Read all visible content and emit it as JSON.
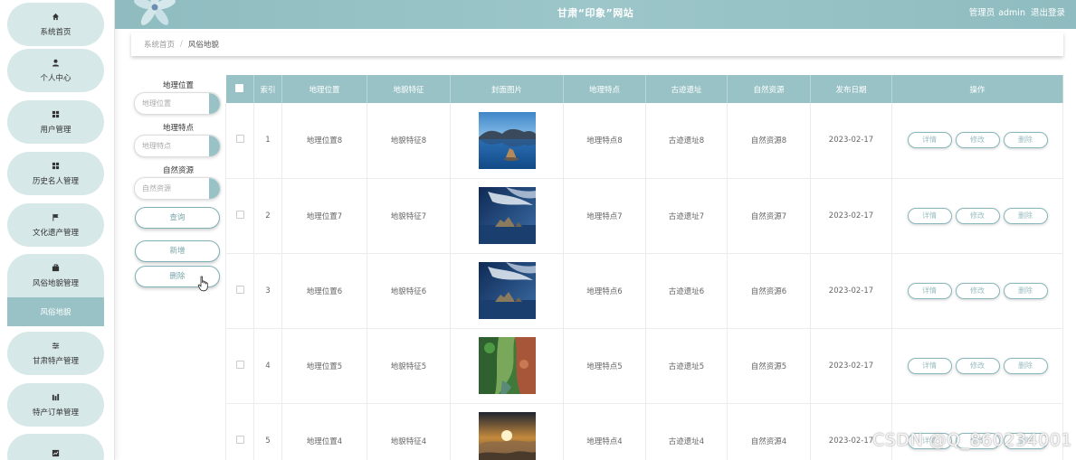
{
  "colors": {
    "primary": "#99c2c6",
    "menu_bg": "#d7e8e9",
    "header_bg": "#8fbcc0"
  },
  "header": {
    "title": "甘肃“印象”网站",
    "role": "管理员",
    "username": "admin",
    "logout": "退出登录"
  },
  "sidebar": {
    "items": [
      {
        "icon": "home-icon",
        "label": "系统首页"
      },
      {
        "icon": "user-icon",
        "label": "个人中心"
      },
      {
        "icon": "grid-icon",
        "label": "用户管理"
      },
      {
        "icon": "grid-icon",
        "label": "历史名人管理"
      },
      {
        "icon": "flag-icon",
        "label": "文化遗产管理"
      },
      {
        "icon": "briefcase-icon",
        "label": "风俗地貌管理"
      },
      {
        "icon": "sliders-icon",
        "label": "甘肃特产管理"
      },
      {
        "icon": "chart-icon",
        "label": "特产订单管理"
      },
      {
        "icon": "line-chart-icon",
        "label": ""
      }
    ],
    "active_sub": "风俗地貌"
  },
  "breadcrumb": {
    "home": "系统首页",
    "separator": "/",
    "current": "风俗地貌"
  },
  "search": {
    "fields": [
      {
        "label": "地理位置",
        "placeholder": "地理位置"
      },
      {
        "label": "地理特点",
        "placeholder": "地理特点"
      },
      {
        "label": "自然资源",
        "placeholder": "自然资源"
      }
    ],
    "query_btn": "查询",
    "add_btn": "新增",
    "delete_btn": "删除"
  },
  "table": {
    "headers": [
      "索引",
      "地理位置",
      "地貌特征",
      "封面图片",
      "地理特点",
      "古迹遗址",
      "自然资源",
      "发布日期",
      "操作"
    ],
    "actions": {
      "detail": "详情",
      "edit": "修改",
      "delete": "删除"
    },
    "rows": [
      {
        "index": "1",
        "location": "地理位置8",
        "landform": "地貌特征8",
        "image": "lake-island",
        "feature": "地理特点8",
        "site": "古迹遗址8",
        "resource": "自然资源8",
        "date": "2023-02-17"
      },
      {
        "index": "2",
        "location": "地理位置7",
        "landform": "地貌特征7",
        "image": "sea-rocks",
        "feature": "地理特点7",
        "site": "古迹遗址7",
        "resource": "自然资源7",
        "date": "2023-02-17"
      },
      {
        "index": "3",
        "location": "地理位置6",
        "landform": "地貌特征6",
        "image": "sea-rocks",
        "feature": "地理特点6",
        "site": "古迹遗址6",
        "resource": "自然资源6",
        "date": "2023-02-17"
      },
      {
        "index": "4",
        "location": "地理位置5",
        "landform": "地貌特征5",
        "image": "canyon",
        "feature": "地理特点5",
        "site": "古迹遗址5",
        "resource": "自然资源5",
        "date": "2023-02-17"
      },
      {
        "index": "5",
        "location": "地理位置4",
        "landform": "地貌特征4",
        "image": "sunset-clouds",
        "feature": "地理特点4",
        "site": "古迹遗址4",
        "resource": "自然资源4",
        "date": "2023-02-17"
      }
    ]
  },
  "watermark": "CSDN @Q_860234001"
}
